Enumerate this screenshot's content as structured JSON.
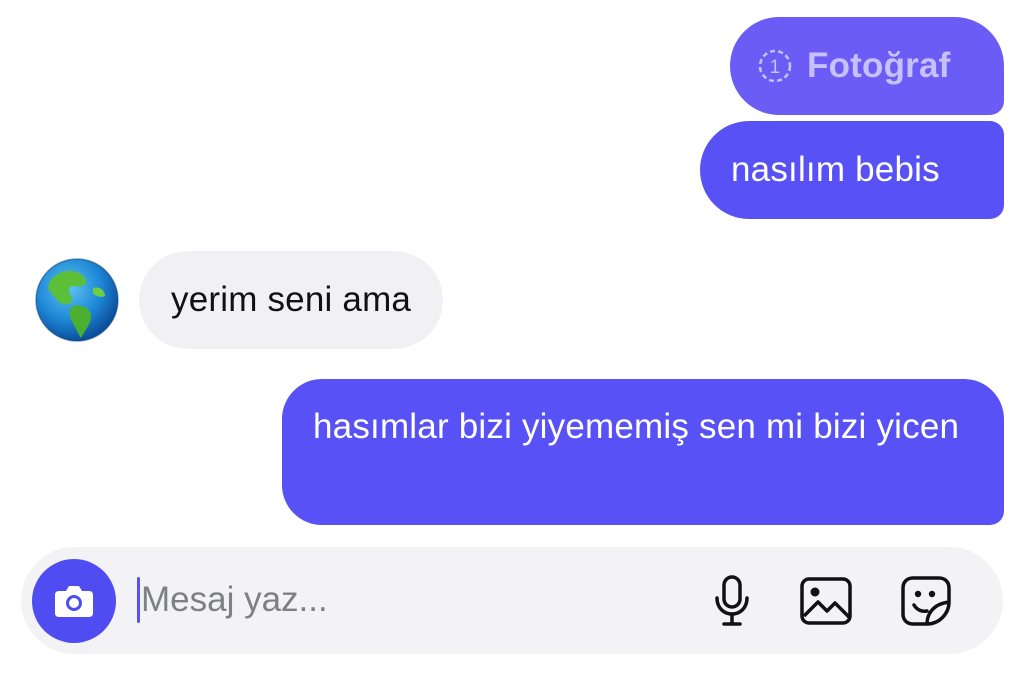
{
  "messages": [
    {
      "direction": "sent",
      "kind": "view-once-photo",
      "label": "Fotoğraf",
      "badge": "1"
    },
    {
      "direction": "sent",
      "kind": "text",
      "text": "nasılım bebis"
    },
    {
      "direction": "received",
      "kind": "text",
      "text": "yerim seni ama",
      "avatar_icon": "globe-americas-icon"
    },
    {
      "direction": "sent",
      "kind": "text",
      "text": "hasımlar bizi yiyememiş sen mi bizi yicen"
    }
  ],
  "composer": {
    "placeholder": "Mesaj yaz...",
    "value": "",
    "camera_icon": "camera-icon",
    "mic_icon": "microphone-icon",
    "gallery_icon": "image-icon",
    "sticker_icon": "sticker-icon"
  },
  "colors": {
    "sent_bubble": "#5851f5",
    "photo_bubble": "#6a5cf4",
    "received_bubble": "#f1f1f3",
    "camera_button": "#4f4cf2",
    "composer_bg": "#f3f3f5"
  }
}
